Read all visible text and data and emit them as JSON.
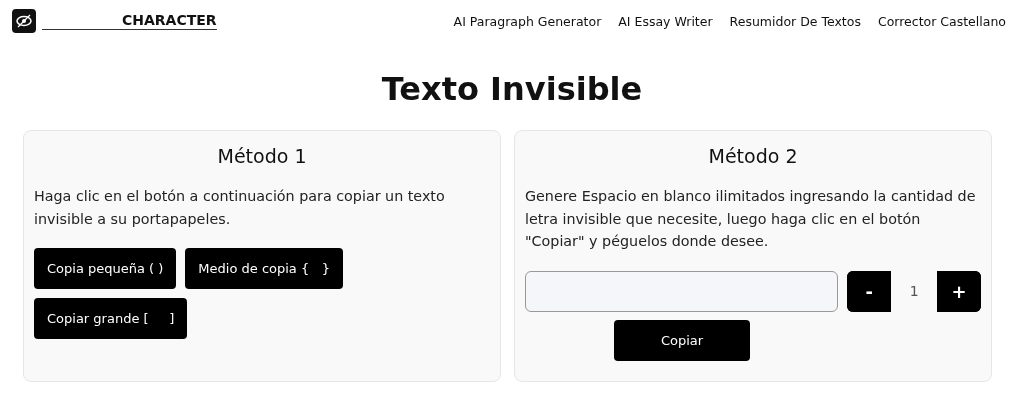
{
  "header": {
    "brand": "CHARACTER",
    "nav": [
      "AI Paragraph Generator",
      "AI Essay Writer",
      "Resumidor De Textos",
      "Corrector Castellano"
    ]
  },
  "title": "Texto Invisible",
  "cards": [
    {
      "kind": "buttons",
      "title": "Método 1",
      "description": "Haga clic en el botón a continuación para copiar un texto invisible a su portapapeles.",
      "buttons": [
        "Copia pequeña ( )",
        "Medio de copia {   }",
        "Copiar grande [     ]"
      ]
    },
    {
      "kind": "generator",
      "title": "Método 2",
      "description": "Genere Espacio en blanco ilimitados ingresando la cantidad de letra invisible que necesite, luego haga clic en el botón \"Copiar\" y péguelos donde desee.",
      "minus": "-",
      "count": "1",
      "plus": "+",
      "copy": "Copiar"
    }
  ]
}
